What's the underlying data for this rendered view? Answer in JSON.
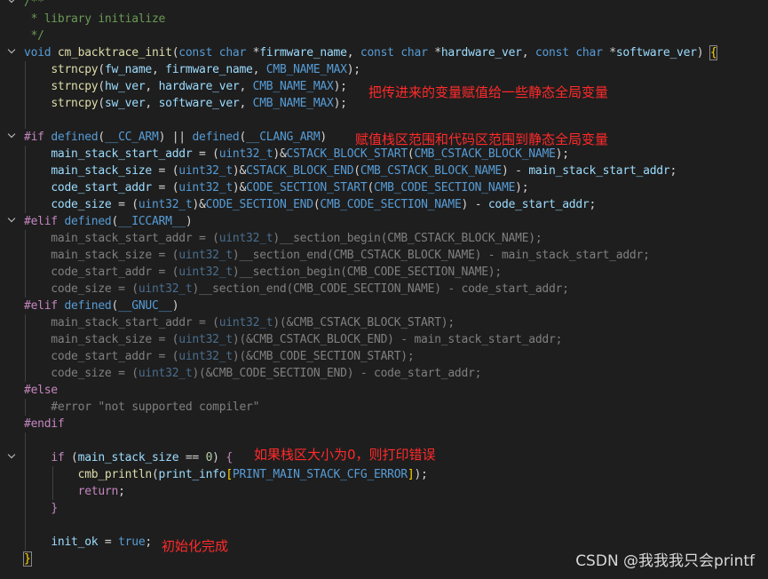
{
  "lines": [
    "/**",
    " * library initialize",
    " */",
    "void cm_backtrace_init(const char *firmware_name, const char *hardware_ver, const char *software_ver) {",
    "    strncpy(fw_name, firmware_name, CMB_NAME_MAX);",
    "    strncpy(hw_ver, hardware_ver, CMB_NAME_MAX);",
    "    strncpy(sw_ver, software_ver, CMB_NAME_MAX);",
    "",
    "#if defined(__CC_ARM) || defined(__CLANG_ARM)",
    "    main_stack_start_addr = (uint32_t)&CSTACK_BLOCK_START(CMB_CSTACK_BLOCK_NAME);",
    "    main_stack_size = (uint32_t)&CSTACK_BLOCK_END(CMB_CSTACK_BLOCK_NAME) - main_stack_start_addr;",
    "    code_start_addr = (uint32_t)&CODE_SECTION_START(CMB_CODE_SECTION_NAME);",
    "    code_size = (uint32_t)&CODE_SECTION_END(CMB_CODE_SECTION_NAME) - code_start_addr;",
    "#elif defined(__ICCARM__)",
    "    main_stack_start_addr = (uint32_t)__section_begin(CMB_CSTACK_BLOCK_NAME);",
    "    main_stack_size = (uint32_t)__section_end(CMB_CSTACK_BLOCK_NAME) - main_stack_start_addr;",
    "    code_start_addr = (uint32_t)__section_begin(CMB_CODE_SECTION_NAME);",
    "    code_size = (uint32_t)__section_end(CMB_CODE_SECTION_NAME) - code_start_addr;",
    "#elif defined(__GNUC__)",
    "    main_stack_start_addr = (uint32_t)(&CMB_CSTACK_BLOCK_START);",
    "    main_stack_size = (uint32_t)(&CMB_CSTACK_BLOCK_END) - main_stack_start_addr;",
    "    code_start_addr = (uint32_t)(&CMB_CODE_SECTION_START);",
    "    code_size = (uint32_t)(&CMB_CODE_SECTION_END) - code_start_addr;",
    "#else",
    "    #error \"not supported compiler\"",
    "#endif",
    "",
    "    if (main_stack_size == 0) {",
    "        cmb_println(print_info[PRINT_MAIN_STACK_CFG_ERROR]);",
    "        return;",
    "    }",
    "",
    "    init_ok = true;",
    "}"
  ],
  "annotations": {
    "copy_vars": "把传进来的变量赋值给一些静态全局变量",
    "assign_ranges": "赋值栈区范围和代码区范围到静态全局变量",
    "check_stack": "如果栈区大小为0，则打印错误",
    "init_done": "初始化完成"
  },
  "watermark": "CSDN @我我我只会printf"
}
